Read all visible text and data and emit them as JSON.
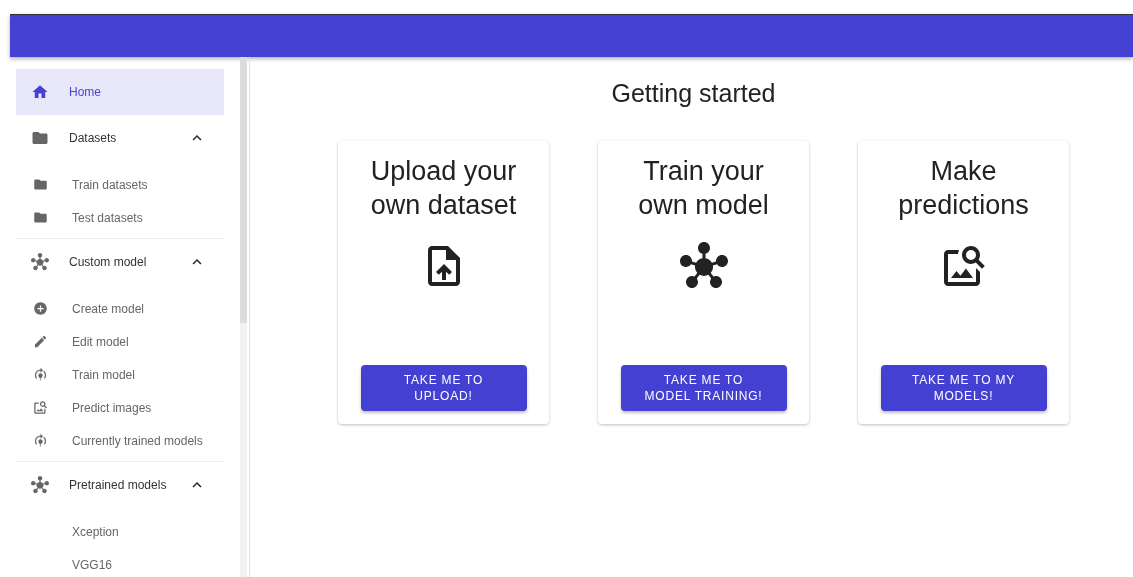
{
  "sidebar": {
    "items": [
      {
        "label": "Home",
        "selected": true
      },
      {
        "label": "Datasets",
        "selected": false,
        "expanded": true,
        "children": [
          {
            "label": "Train datasets"
          },
          {
            "label": "Test datasets"
          }
        ]
      },
      {
        "label": "Custom model",
        "selected": false,
        "expanded": true,
        "children": [
          {
            "label": "Create model"
          },
          {
            "label": "Edit model"
          },
          {
            "label": "Train model"
          },
          {
            "label": "Predict images"
          },
          {
            "label": "Currently trained models"
          }
        ]
      },
      {
        "label": "Pretrained models",
        "selected": false,
        "expanded": true,
        "children": [
          {
            "label": "Xception"
          },
          {
            "label": "VGG16"
          }
        ]
      }
    ]
  },
  "main": {
    "title": "Getting started",
    "cards": [
      {
        "title": "Upload your own dataset",
        "button": "TAKE ME TO UPLOAD!"
      },
      {
        "title": "Train your own model",
        "button": "TAKE ME TO MODEL TRAINING!"
      },
      {
        "title": "Make predictions",
        "button": "TAKE ME TO MY MODELS!"
      }
    ]
  }
}
